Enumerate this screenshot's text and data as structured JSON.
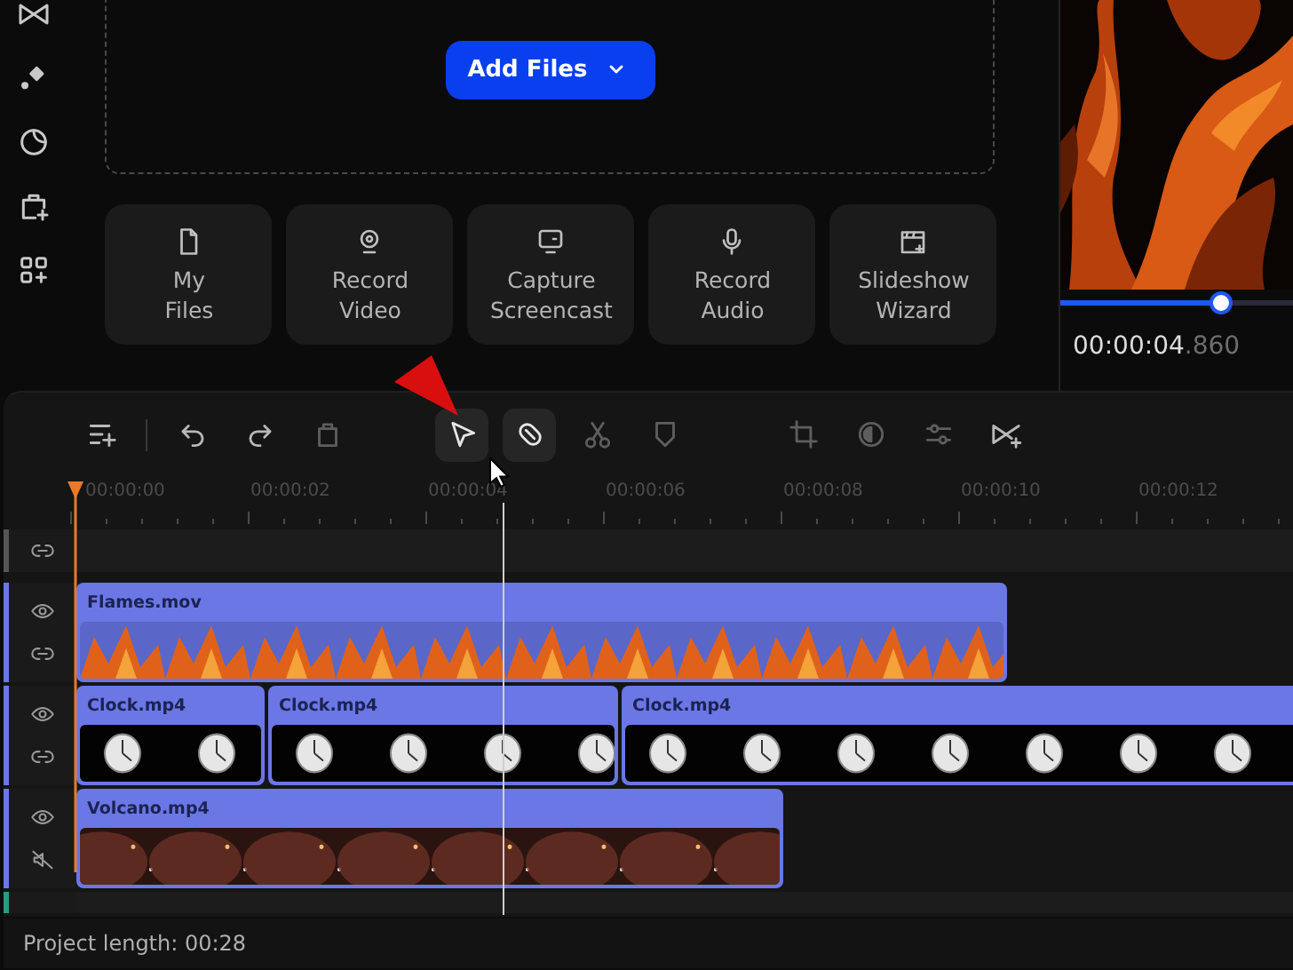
{
  "import_area": {
    "add_button": "Add Files"
  },
  "tiles": [
    {
      "label": "My\nFiles"
    },
    {
      "label": "Record\nVideo"
    },
    {
      "label": "Capture\nScreencast"
    },
    {
      "label": "Record\nAudio"
    },
    {
      "label": "Slideshow\nWizard"
    }
  ],
  "preview": {
    "level": 0.69,
    "time": "00:00:04",
    "time_fraction": ".860"
  },
  "toolbar": {
    "groups": [
      [
        {
          "disabled": false,
          "on": false
        }
      ],
      [
        {
          "disabled": false,
          "on": false
        },
        {
          "disabled": false,
          "on": false
        },
        {
          "disabled": true,
          "on": false
        }
      ],
      [
        {
          "disabled": false,
          "on": true
        },
        {
          "disabled": false,
          "on": true
        },
        {
          "disabled": true,
          "on": false
        },
        {
          "disabled": true,
          "on": false
        }
      ],
      [
        {
          "disabled": true,
          "on": false
        },
        {
          "disabled": true,
          "on": false
        },
        {
          "disabled": true,
          "on": false
        },
        {
          "disabled": false,
          "on": false
        }
      ]
    ]
  },
  "ruler": {
    "labels": [
      "00:00:00",
      "00:00:02",
      "00:00:04",
      "00:00:06",
      "00:00:08",
      "00:00:10",
      "00:00:12"
    ]
  },
  "tracks": [
    {
      "kind": "empty"
    },
    {
      "kind": "video",
      "clips": [
        {
          "name": "Flames.mov"
        }
      ]
    },
    {
      "kind": "video",
      "clips": [
        {
          "name": "Clock.mp4"
        },
        {
          "name": "Clock.mp4"
        },
        {
          "name": "Clock.mp4"
        }
      ]
    },
    {
      "kind": "muted",
      "clips": [
        {
          "name": "Volcano.mp4"
        }
      ]
    },
    {
      "kind": "audio"
    }
  ],
  "status_bar": {
    "text": "Project length: 00:28"
  }
}
